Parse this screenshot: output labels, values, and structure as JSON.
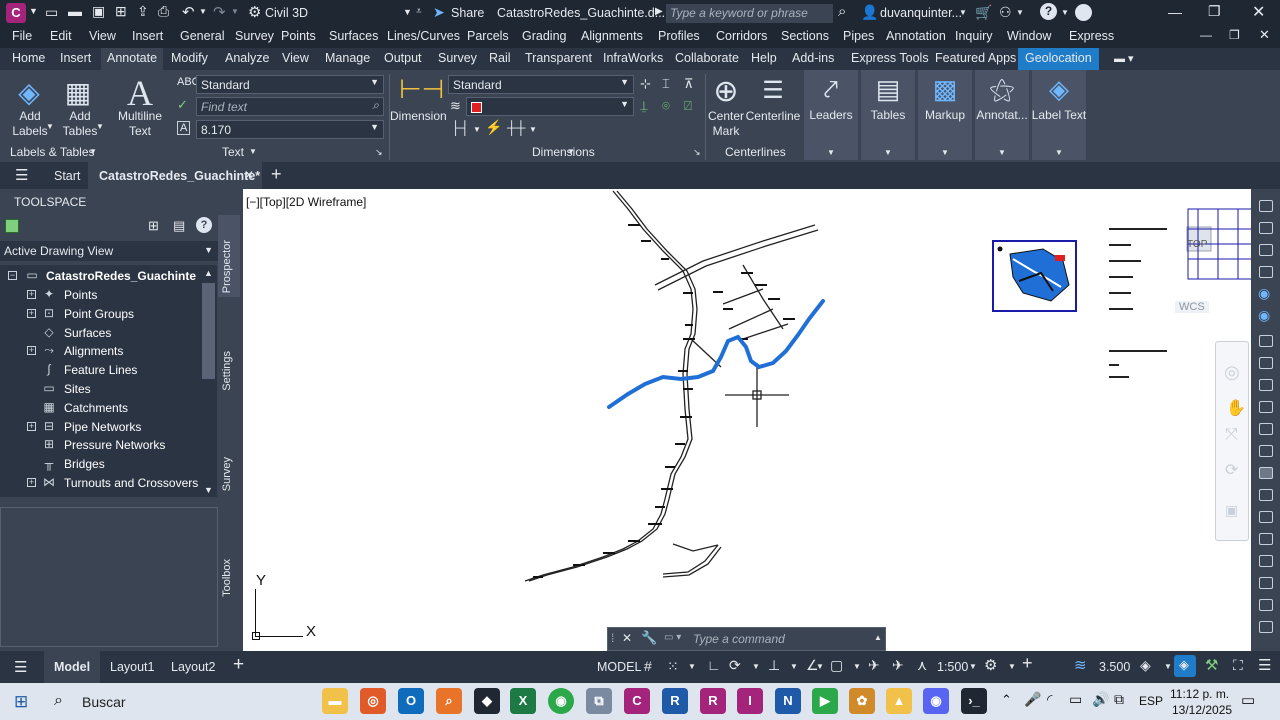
{
  "app": {
    "logo": "C",
    "workspace": "Civil 3D",
    "share": "Share",
    "doc_title": "CatastroRedes_Guachinte.d...",
    "search_placeholder": "Type a keyword or phrase",
    "user": "duvanquinter..."
  },
  "menu": [
    "File",
    "Edit",
    "View",
    "Insert",
    "General",
    "Survey",
    "Points",
    "Surfaces",
    "Lines/Curves",
    "Parcels",
    "Grading",
    "Alignments",
    "Profiles",
    "Corridors",
    "Sections",
    "Pipes",
    "Annotation",
    "Inquiry",
    "Window",
    "Express"
  ],
  "ribbon_tabs": [
    "Home",
    "Insert",
    "Annotate",
    "Modify",
    "Analyze",
    "View",
    "Manage",
    "Output",
    "Survey",
    "Rail",
    "Transparent",
    "InfraWorks",
    "Collaborate",
    "Help",
    "Add-ins",
    "Express Tools",
    "Featured Apps",
    "Geolocation"
  ],
  "ribbon": {
    "add_labels": "Add\nLabels",
    "add_tables": "Add\nTables",
    "multiline_text": "Multiline\nText",
    "text_style": "Standard",
    "find_text_placeholder": "Find text",
    "text_height": "8.170",
    "labels_tables_title": "Labels & Tables",
    "text_title": "Text",
    "dimension": "Dimension",
    "dim_style": "Standard",
    "dimensions_title": "Dimensions",
    "center_mark": "Center\nMark",
    "centerline": "Centerline",
    "centerlines_title": "Centerlines",
    "leaders": "Leaders",
    "tables": "Tables",
    "markup": "Markup",
    "annotation_scaling": "Annotat...",
    "label_text": "Label Text"
  },
  "doc_tabs": {
    "start": "Start",
    "active": "CatastroRedes_Guachinte*"
  },
  "toolspace": {
    "title": "TOOLSPACE",
    "view": "Active Drawing View",
    "root": "CatastroRedes_Guachinte",
    "items": [
      {
        "label": "Points",
        "expand": true,
        "icon": "✦"
      },
      {
        "label": "Point Groups",
        "expand": true,
        "icon": "⊡"
      },
      {
        "label": "Surfaces",
        "expand": false,
        "icon": "◇"
      },
      {
        "label": "Alignments",
        "expand": true,
        "icon": "⤳"
      },
      {
        "label": "Feature Lines",
        "expand": false,
        "icon": "∫"
      },
      {
        "label": "Sites",
        "expand": false,
        "icon": "▭"
      },
      {
        "label": "Catchments",
        "expand": false,
        "icon": "▦"
      },
      {
        "label": "Pipe Networks",
        "expand": true,
        "icon": "⊟"
      },
      {
        "label": "Pressure Networks",
        "expand": false,
        "icon": "⊞"
      },
      {
        "label": "Bridges",
        "expand": false,
        "icon": "╥"
      },
      {
        "label": "Turnouts and Crossovers",
        "expand": true,
        "icon": "⋈"
      }
    ],
    "side_tabs": [
      "Prospector",
      "Settings",
      "Survey",
      "Toolbox"
    ]
  },
  "viewport": {
    "label": "[−][Top][2D Wireframe]",
    "viewcube_top": "TOP",
    "wcs": "WCS",
    "axis_x": "X",
    "axis_y": "Y",
    "command_placeholder": "Type a command"
  },
  "status": {
    "layouts": [
      "Model",
      "Layout1",
      "Layout2"
    ],
    "model_btn": "MODEL",
    "scale": "1:500",
    "annotation_scale": "3.500"
  },
  "taskbar": {
    "search": "Buscar",
    "time": "11:12 p. m.",
    "date": "13/12/2025",
    "lang": "ESP"
  },
  "colors": {
    "accent": "#1e7cc8",
    "river": "#1f6fd6",
    "lines": "#222222"
  }
}
